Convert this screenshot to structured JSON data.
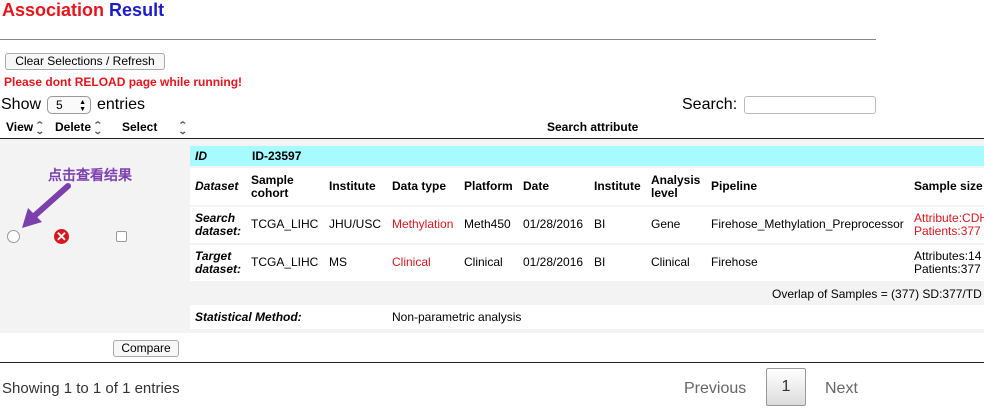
{
  "title": {
    "word1": "Association",
    "word2": "Result"
  },
  "toolbar": {
    "clear_label": "Clear Selections / Refresh",
    "warning": "Please dont RELOAD page while running!"
  },
  "length": {
    "show": "Show",
    "value": "5",
    "entries": "entries"
  },
  "search": {
    "label": "Search:",
    "value": ""
  },
  "headers": {
    "view": "View",
    "delete": "Delete",
    "select": "Select",
    "attribute": "Search attribute"
  },
  "annotation": "点击查看结果",
  "detail": {
    "id_label": "ID",
    "id_value": "ID-23597",
    "columns": [
      "Dataset",
      "Sample cohort",
      "Institute",
      "Data type",
      "Platform",
      "Date",
      "Institute",
      "Analysis level",
      "Pipeline",
      "Sample size"
    ],
    "search_row": [
      "Search dataset:",
      "TCGA_LIHC",
      "JHU/USC",
      "Methylation",
      "Meth450",
      "01/28/2016",
      "BI",
      "Gene",
      "Firehose_Methylation_Preprocessor",
      "Attribute:CDH",
      "Patients:377"
    ],
    "target_row": [
      "Target dataset:",
      "TCGA_LIHC",
      "MS",
      "Clinical",
      "Clinical",
      "01/28/2016",
      "BI",
      "Clinical",
      "Firehose",
      "Attributes:14",
      "Patients:377"
    ],
    "overlap": "Overlap of Samples = (377) SD:377/TD",
    "stat_label": "Statistical Method:",
    "stat_value": "Non-parametric analysis"
  },
  "compare_label": "Compare",
  "footer": {
    "info": "Showing 1 to 1 of 1 entries",
    "previous": "Previous",
    "page": "1",
    "next": "Next"
  },
  "colors": {
    "accent_red": "#e8141c",
    "title_blue": "#1c1ccc",
    "id_row_bg": "#a6fbff",
    "annotation_purple": "#7c3fae"
  }
}
